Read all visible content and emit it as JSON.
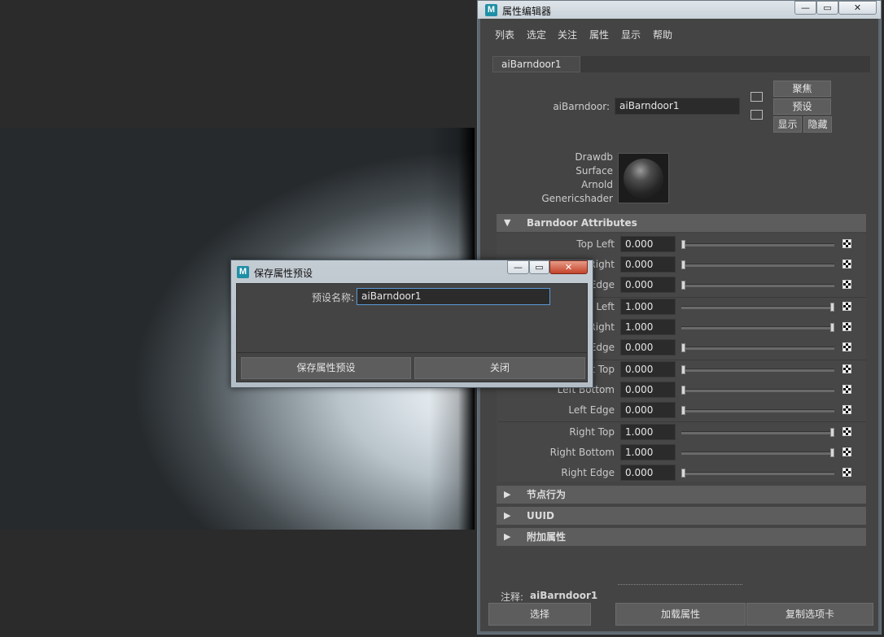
{
  "attribute_editor": {
    "title": "属性编辑器",
    "logo_letter": "M",
    "window_buttons": {
      "minimize": "—",
      "maximize": "▭",
      "close": "✕"
    },
    "menu": [
      "列表",
      "选定",
      "关注",
      "属性",
      "显示",
      "帮助"
    ],
    "tab": "aiBarndoor1",
    "node_type_label": "aiBarndoor:",
    "node_name": "aiBarndoor1",
    "side_buttons": {
      "focus": "聚焦",
      "presets": "预设",
      "show": "显示",
      "hide": "隐藏"
    },
    "swatch_labels": [
      "Drawdb",
      "Surface",
      "Arnold",
      "Genericshader"
    ],
    "sections": {
      "barndoor": "Barndoor Attributes",
      "node_behavior": "节点行为",
      "uuid": "UUID",
      "extra": "附加属性"
    },
    "attributes": [
      {
        "label": "Top Left",
        "value": "0.000",
        "level": 0
      },
      {
        "label": "Top Right",
        "value": "0.000",
        "level": 0
      },
      {
        "label": "Top Edge",
        "value": "0.000",
        "level": 0
      },
      {
        "label": "Bottom Left",
        "value": "1.000",
        "level": 1
      },
      {
        "label": "Bottom Right",
        "value": "1.000",
        "level": 1
      },
      {
        "label": "Bottom Edge",
        "value": "0.000",
        "level": 0
      },
      {
        "label": "Left Top",
        "value": "0.000",
        "level": 0
      },
      {
        "label": "Left Bottom",
        "value": "0.000",
        "level": 0
      },
      {
        "label": "Left Edge",
        "value": "0.000",
        "level": 0
      },
      {
        "label": "Right Top",
        "value": "1.000",
        "level": 1
      },
      {
        "label": "Right Bottom",
        "value": "1.000",
        "level": 1
      },
      {
        "label": "Right Edge",
        "value": "0.000",
        "level": 0
      }
    ],
    "note_label": "注释:",
    "note_value": "aiBarndoor1",
    "bottom_buttons": {
      "select": "选择",
      "load": "加载属性",
      "copy_tab": "复制选项卡"
    }
  },
  "save_preset_dialog": {
    "title": "保存属性预设",
    "logo_letter": "M",
    "window_buttons": {
      "minimize": "—",
      "maximize": "▭",
      "close": "✕"
    },
    "name_label": "预设名称:",
    "name_value": "aiBarndoor1",
    "save_button": "保存属性预设",
    "close_button": "关闭"
  },
  "colors": {
    "panel_bg": "#444444",
    "field_bg": "#2b2b2b",
    "section_header": "#5d5d5d",
    "maya_logo": "#1f8fa6",
    "focus_border": "#5a9ad5"
  }
}
